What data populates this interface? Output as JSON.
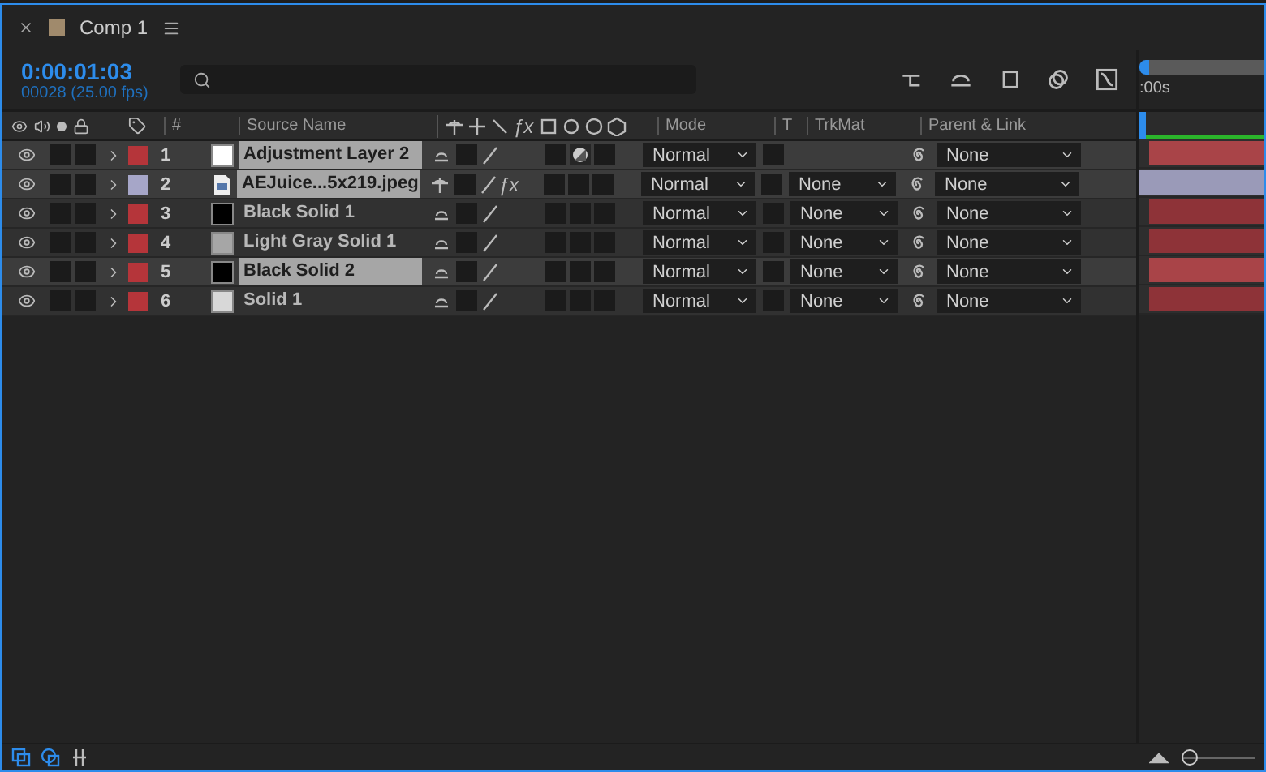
{
  "tab": {
    "title": "Comp 1",
    "color": "#a08a6c"
  },
  "timecode": "0:00:01:03",
  "frame_info": "00028 (25.00 fps)",
  "ruler_label": ":00s",
  "columns": {
    "number": "#",
    "source_name": "Source Name",
    "fx": "ƒx",
    "mode": "Mode",
    "t": "T",
    "trkmat": "TrkMat",
    "parent": "Parent & Link"
  },
  "layers": [
    {
      "number": "1",
      "name": "Adjustment Layer 2",
      "kind": "solid",
      "label": {
        "color": "#b5353a"
      },
      "swatch": {
        "color": "#ffffff"
      },
      "selected": true,
      "adjustment": true,
      "mode": "Normal",
      "parent": "None",
      "bar": {
        "color": "#a94448"
      }
    },
    {
      "number": "2",
      "name": "AEJuice...5x219.jpeg",
      "kind": "footage",
      "label": {
        "color": "#a6a6c8"
      },
      "selected": true,
      "fx": "ƒx",
      "adjustment": false,
      "mode": "Normal",
      "trkmat": "None",
      "parent": "None",
      "bar": {
        "color": "#9a9ab8"
      }
    },
    {
      "number": "3",
      "name": "Black Solid 1",
      "kind": "solid",
      "label": {
        "color": "#b5353a"
      },
      "swatch": {
        "color": "#000000"
      },
      "selected": false,
      "adjustment": false,
      "mode": "Normal",
      "trkmat": "None",
      "parent": "None",
      "bar": {
        "color": "#8e3338"
      }
    },
    {
      "number": "4",
      "name": "Light Gray Solid 1",
      "kind": "solid",
      "label": {
        "color": "#b5353a"
      },
      "swatch": {
        "color": "#a6a6a6"
      },
      "selected": false,
      "adjustment": false,
      "mode": "Normal",
      "trkmat": "None",
      "parent": "None",
      "bar": {
        "color": "#8e3338"
      }
    },
    {
      "number": "5",
      "name": "Black Solid 2",
      "kind": "solid",
      "label": {
        "color": "#b5353a"
      },
      "swatch": {
        "color": "#000000"
      },
      "selected": true,
      "adjustment": false,
      "mode": "Normal",
      "trkmat": "None",
      "parent": "None",
      "bar": {
        "color": "#a94448"
      }
    },
    {
      "number": "6",
      "name": "Solid 1",
      "kind": "solid",
      "label": {
        "color": "#b5353a"
      },
      "swatch": {
        "color": "#d8d8d8"
      },
      "selected": false,
      "adjustment": false,
      "mode": "Normal",
      "trkmat": "None",
      "parent": "None",
      "bar": {
        "color": "#8e3338"
      }
    }
  ],
  "zoom": {
    "level": 0
  }
}
